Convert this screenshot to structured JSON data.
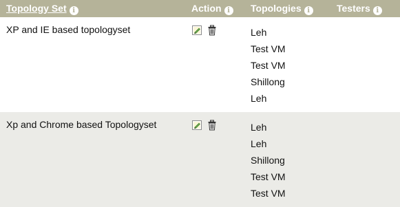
{
  "header": {
    "topology_set": "Topology Set",
    "action": "Action",
    "topologies": "Topologies",
    "testers": "Testers"
  },
  "rows": [
    {
      "name": "XP and IE based topologyset",
      "topologies": [
        "Leh",
        "Test VM",
        "Test VM",
        "Shillong",
        "Leh"
      ]
    },
    {
      "name": "Xp and Chrome based Topologyset",
      "topologies": [
        "Leh",
        "Leh",
        "Shillong",
        "Test VM",
        "Test VM"
      ]
    }
  ],
  "icons": {
    "info": "info-icon",
    "edit": "edit-icon",
    "delete": "trash-icon"
  },
  "colors": {
    "header_bg": "#b5b399",
    "row_alt_bg": "#ebebe7"
  }
}
